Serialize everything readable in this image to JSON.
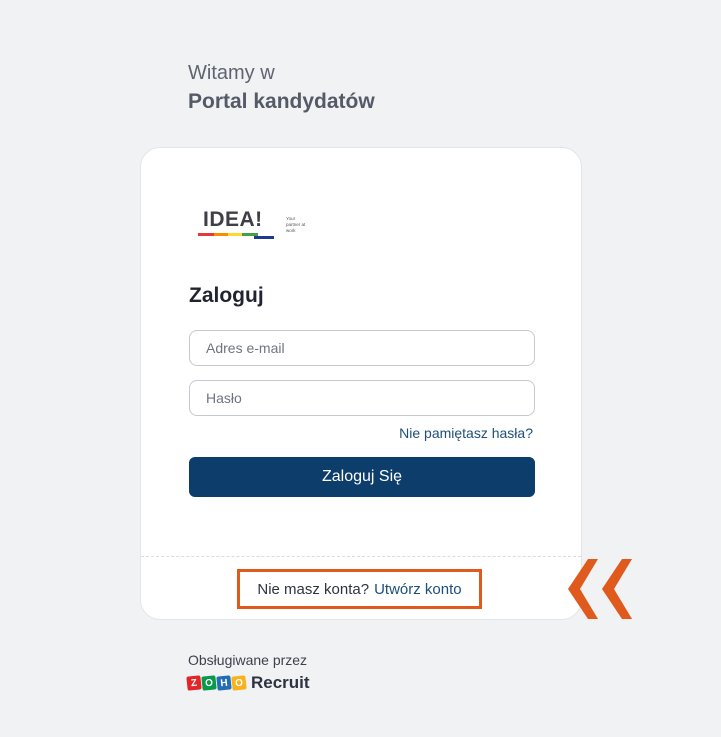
{
  "welcome": {
    "line1": "Witamy w",
    "line2": "Portal kandydatów"
  },
  "logo": {
    "name": "IDEA!",
    "tagline": "Your partner at work"
  },
  "form": {
    "title": "Zaloguj",
    "email_placeholder": "Adres e-mail",
    "password_placeholder": "Hasło",
    "forgot_label": "Nie pamiętasz hasła?",
    "submit_label": "Zaloguj Się"
  },
  "signup": {
    "prompt": "Nie masz konta?",
    "link_label": "Utwórz konto"
  },
  "footer": {
    "powered_by": "Obsługiwane przez",
    "zoho_letters": [
      "Z",
      "O",
      "H",
      "O"
    ],
    "product": "Recruit"
  },
  "colors": {
    "primary": "#0c3d6b",
    "link": "#1d4f7a",
    "highlight": "#e05a1e",
    "zoho_tiles": [
      "#e42527",
      "#089949",
      "#226db4",
      "#f9b21d"
    ],
    "logo_stripes": [
      "#e53935",
      "#fb8c00",
      "#fdd835",
      "#43a047",
      "#1e88e5"
    ]
  },
  "annotation": {
    "icon": "double-chevron-left-icon"
  }
}
